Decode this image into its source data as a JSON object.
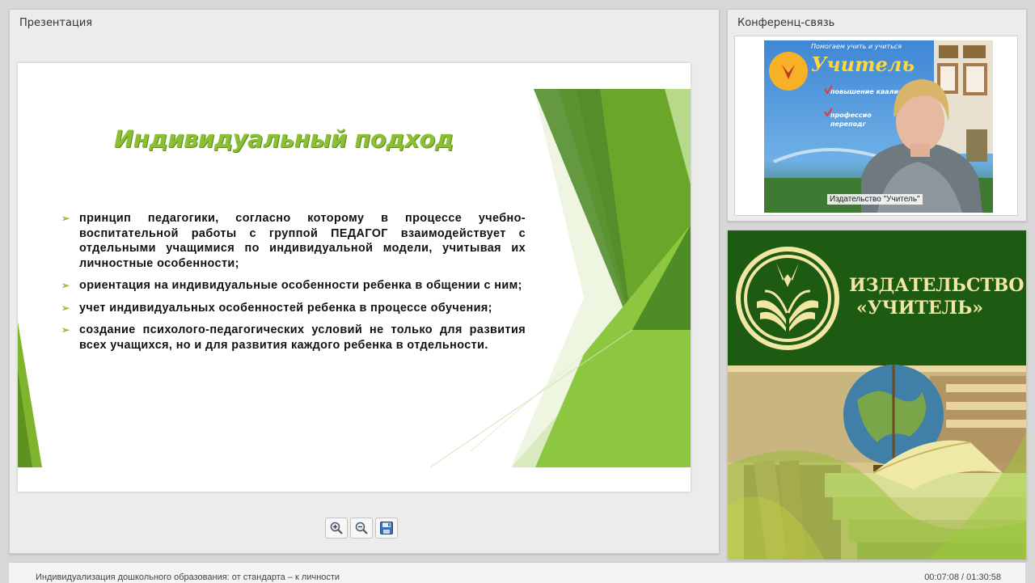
{
  "presentation": {
    "title": "Презентация",
    "slide": {
      "heading": "Индивидуальный подход",
      "bullets": [
        "принцип педагогики, согласно которому в процессе учебно-воспитательной работы с группой ПЕДАГОГ взаимодействует с отдельными учащимися по индивидуальной модели, учитывая их личностные особенности;",
        "ориентация на индивидуальные особенности ребенка в общении с ним;",
        "учет индивидуальных особенностей ребенка в процессе обучения;",
        "создание психолого-педагогических условий не только для развития всех учащихся, но и для развития каждого ребенка в отдельности."
      ],
      "bullet_marker": "➢"
    },
    "toolbar": {
      "zoom_in_icon": "zoom-in-icon",
      "zoom_out_icon": "zoom-out-icon",
      "save_icon": "save-icon"
    }
  },
  "conference": {
    "title": "Конференц-связь",
    "video_caption": "Издательство \"Учитель\"",
    "banner_top": "Помогаем учить и учиться",
    "banner_brand": "Учитель",
    "banner_items": [
      "повышение квалифи",
      "профессио",
      "переподг"
    ]
  },
  "publisher": {
    "name_line1": "ИЗДАТЕЛЬСТВО",
    "name_line2": "«УЧИТЕЛЬ»"
  },
  "footer": {
    "course_title": "Индивидуализация дошкольного образования: от стандарта – к личности",
    "time": "00:07:08 / 01:30:58"
  },
  "colors": {
    "accent_green": "#8bc034",
    "dark_green": "#1d5a12",
    "gold": "#f2e6a4"
  }
}
